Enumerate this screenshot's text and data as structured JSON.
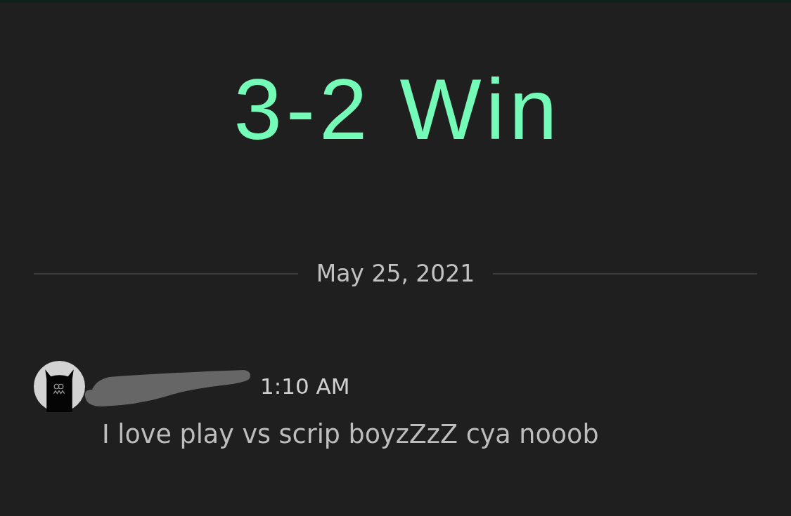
{
  "result": {
    "title": "3-2 Win"
  },
  "date_divider": {
    "label": "May 25, 2021"
  },
  "message": {
    "author_redacted": true,
    "time": "1:10 AM",
    "text": "I love play vs scrip boyzZzZ cya nooob"
  }
}
